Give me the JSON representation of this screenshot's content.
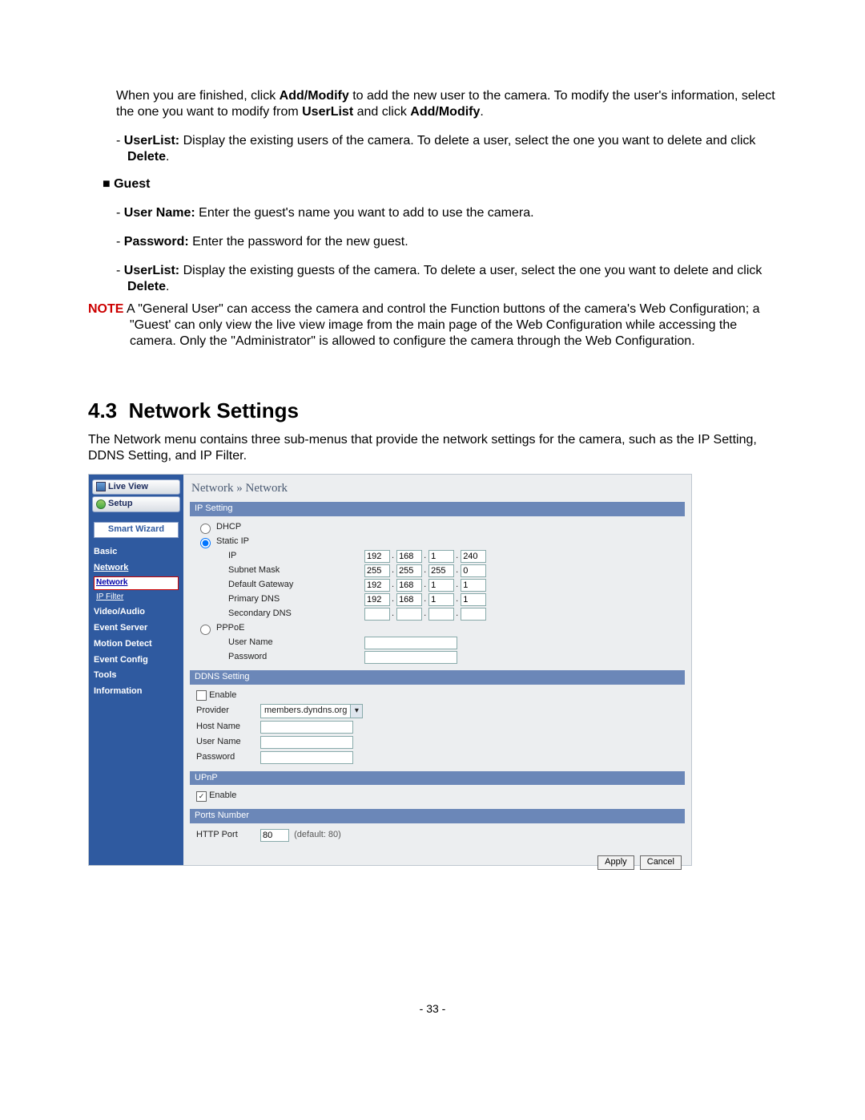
{
  "intro_p1_a": "When you are finished, click ",
  "intro_p1_bold1": "Add/Modify",
  "intro_p1_b": " to add the new user to the camera. To modify the user's information, select the one you want to modify from ",
  "intro_p1_bold2": "UserList",
  "intro_p1_c": " and click ",
  "intro_p1_bold3": "Add/Modify",
  "intro_p1_d": ".",
  "userlist_dash_bold": "UserList:",
  "userlist_dash_rest": " Display the existing users of the camera. To delete a user, select the one you want to delete and click ",
  "userlist_dash_bold_end": "Delete",
  "userlist_dash_period": ".",
  "guest_head": "Guest",
  "guest_items": [
    {
      "bold": "User Name:",
      "rest": " Enter the guest's name you want to add to use the camera."
    },
    {
      "bold": "Password:",
      "rest": " Enter the password for the new guest."
    }
  ],
  "guest_userlist_bold": "UserList:",
  "guest_userlist_rest": " Display the existing guests of the camera. To delete a user, select the one you want to delete and click ",
  "guest_userlist_bold_end": "Delete",
  "guest_userlist_period": ".",
  "note_label": "NOTE",
  "note_text": " A \"General User\" can access the camera and control the Function buttons of the camera's Web Configuration; a \"Guest' can only view the live view image from the main page of the Web Configuration while accessing the camera. Only the \"Administrator\" is allowed to configure the camera through the Web Configuration.",
  "section_number": "4.3",
  "section_title": "Network Settings",
  "section_intro": "The Network menu contains three sub-menus that provide the network settings for the camera, such as the IP Setting, DDNS Setting, and IP Filter.",
  "ui": {
    "tabs": {
      "live": "Live View",
      "setup": "Setup"
    },
    "smart_wizard": "Smart Wizard",
    "nav": [
      "Basic",
      "Network",
      "Video/Audio",
      "Event Server",
      "Motion Detect",
      "Event Config",
      "Tools",
      "Information"
    ],
    "subnav": {
      "network": "Network",
      "ipfilter": "IP Filter"
    },
    "breadcrumb": "Network » Network",
    "ip_setting": {
      "bar": "IP Setting",
      "dhcp": "DHCP",
      "static": "Static IP",
      "labels": {
        "ip": "IP",
        "mask": "Subnet Mask",
        "gw": "Default Gateway",
        "pdns": "Primary DNS",
        "sdns": "Secondary DNS"
      },
      "ip": [
        "192",
        "168",
        "1",
        "240"
      ],
      "mask": [
        "255",
        "255",
        "255",
        "0"
      ],
      "gw": [
        "192",
        "168",
        "1",
        "1"
      ],
      "pdns": [
        "192",
        "168",
        "1",
        "1"
      ],
      "sdns": [
        "",
        "",
        "",
        ""
      ],
      "pppoe": "PPPoE",
      "pppoe_user_label": "User Name",
      "pppoe_pass_label": "Password"
    },
    "ddns": {
      "bar": "DDNS Setting",
      "enable": "Enable",
      "provider_label": "Provider",
      "provider_value": "members.dyndns.org",
      "host_label": "Host Name",
      "user_label": "User Name",
      "pass_label": "Password"
    },
    "upnp": {
      "bar": "UPnP",
      "enable": "Enable",
      "checked": true
    },
    "ports": {
      "bar": "Ports Number",
      "http_label": "HTTP Port",
      "http_value": "80",
      "http_hint": "(default: 80)"
    },
    "buttons": {
      "apply": "Apply",
      "cancel": "Cancel"
    }
  },
  "page_number": "- 33 -"
}
